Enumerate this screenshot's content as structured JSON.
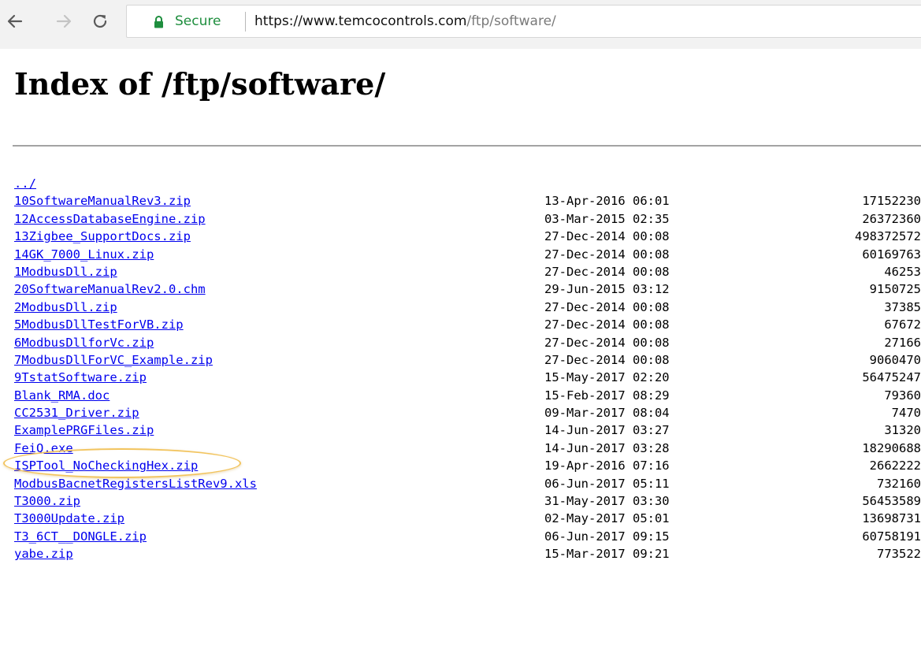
{
  "browser": {
    "secure_label": "Secure",
    "url_host": "https://www.temcocontrols.com",
    "url_path": "/ftp/software/"
  },
  "page": {
    "title": "Index of /ftp/software/",
    "parent_link": "../"
  },
  "files": [
    {
      "name": "10SoftwareManualRev3.zip",
      "date": "13-Apr-2016 06:01",
      "size": "17152230"
    },
    {
      "name": "12AccessDatabaseEngine.zip",
      "date": "03-Mar-2015 02:35",
      "size": "26372360"
    },
    {
      "name": "13Zigbee_SupportDocs.zip",
      "date": "27-Dec-2014 00:08",
      "size": "498372572"
    },
    {
      "name": "14GK_7000_Linux.zip",
      "date": "27-Dec-2014 00:08",
      "size": "60169763"
    },
    {
      "name": "1ModbusDll.zip",
      "date": "27-Dec-2014 00:08",
      "size": "46253"
    },
    {
      "name": "20SoftwareManualRev2.0.chm",
      "date": "29-Jun-2015 03:12",
      "size": "9150725"
    },
    {
      "name": "2ModbusDll.zip",
      "date": "27-Dec-2014 00:08",
      "size": "37385"
    },
    {
      "name": "5ModbusDllTestForVB.zip",
      "date": "27-Dec-2014 00:08",
      "size": "67672"
    },
    {
      "name": "6ModbusDllforVc.zip",
      "date": "27-Dec-2014 00:08",
      "size": "27166"
    },
    {
      "name": "7ModbusDllForVC_Example.zip",
      "date": "27-Dec-2014 00:08",
      "size": "9060470"
    },
    {
      "name": "9TstatSoftware.zip",
      "date": "15-May-2017 02:20",
      "size": "56475247"
    },
    {
      "name": "Blank_RMA.doc",
      "date": "15-Feb-2017 08:29",
      "size": "79360"
    },
    {
      "name": "CC2531_Driver.zip",
      "date": "09-Mar-2017 08:04",
      "size": "7470"
    },
    {
      "name": "ExamplePRGFiles.zip",
      "date": "14-Jun-2017 03:27",
      "size": "31320"
    },
    {
      "name": "FeiQ.exe",
      "date": "14-Jun-2017 03:28",
      "size": "18290688"
    },
    {
      "name": "ISPTool_NoCheckingHex.zip",
      "date": "19-Apr-2016 07:16",
      "size": "2662222"
    },
    {
      "name": "ModbusBacnetRegistersListRev9.xls",
      "date": "06-Jun-2017 05:11",
      "size": "732160"
    },
    {
      "name": "T3000.zip",
      "date": "31-May-2017 03:30",
      "size": "56453589"
    },
    {
      "name": "T3000Update.zip",
      "date": "02-May-2017 05:01",
      "size": "13698731"
    },
    {
      "name": "T3_6CT__DONGLE.zip",
      "date": "06-Jun-2017 09:15",
      "size": "60758191"
    },
    {
      "name": "yabe.zip",
      "date": "15-Mar-2017 09:21",
      "size": "773522"
    }
  ],
  "colors": {
    "link": "#0000ee",
    "secure": "#1e8e3e",
    "highlight": "#f2c45e"
  },
  "icons": {
    "back": "back-arrow-icon",
    "forward": "forward-arrow-icon",
    "reload": "reload-icon",
    "lock": "lock-icon"
  }
}
